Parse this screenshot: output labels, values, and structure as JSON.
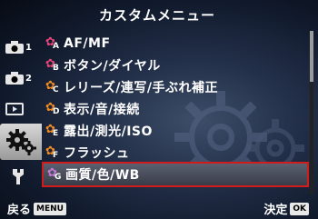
{
  "title": "カスタムメニュー",
  "sidebar": {
    "items": [
      {
        "icon": "camera-icon",
        "num": "1"
      },
      {
        "icon": "camera-icon",
        "num": "2"
      },
      {
        "icon": "playback-icon",
        "num": ""
      },
      {
        "icon": "custom-gears-icon",
        "num": ""
      },
      {
        "icon": "wrench-icon",
        "num": ""
      }
    ],
    "active_index": 3
  },
  "menu": {
    "items": [
      {
        "letter": "A",
        "label": "AF/MF"
      },
      {
        "letter": "B",
        "label": "ボタン/ダイヤル"
      },
      {
        "letter": "C",
        "label": "レリーズ/連写/手ぶれ補正"
      },
      {
        "letter": "D",
        "label": "表示/音/接続"
      },
      {
        "letter": "E",
        "label": "露出/測光/ISO"
      },
      {
        "letter": "F",
        "label": "フラッシュ"
      },
      {
        "letter": "G",
        "label": "画質/色/WB"
      }
    ],
    "selected_index": 6
  },
  "colors": {
    "accent_pink": "#e8467a",
    "accent_orange": "#f08a24",
    "accent_purple": "#c47ad8",
    "selection_border": "#d21c1c"
  },
  "footer": {
    "back_label": "戻る",
    "back_key": "MENU",
    "ok_label": "決定",
    "ok_key": "OK"
  }
}
